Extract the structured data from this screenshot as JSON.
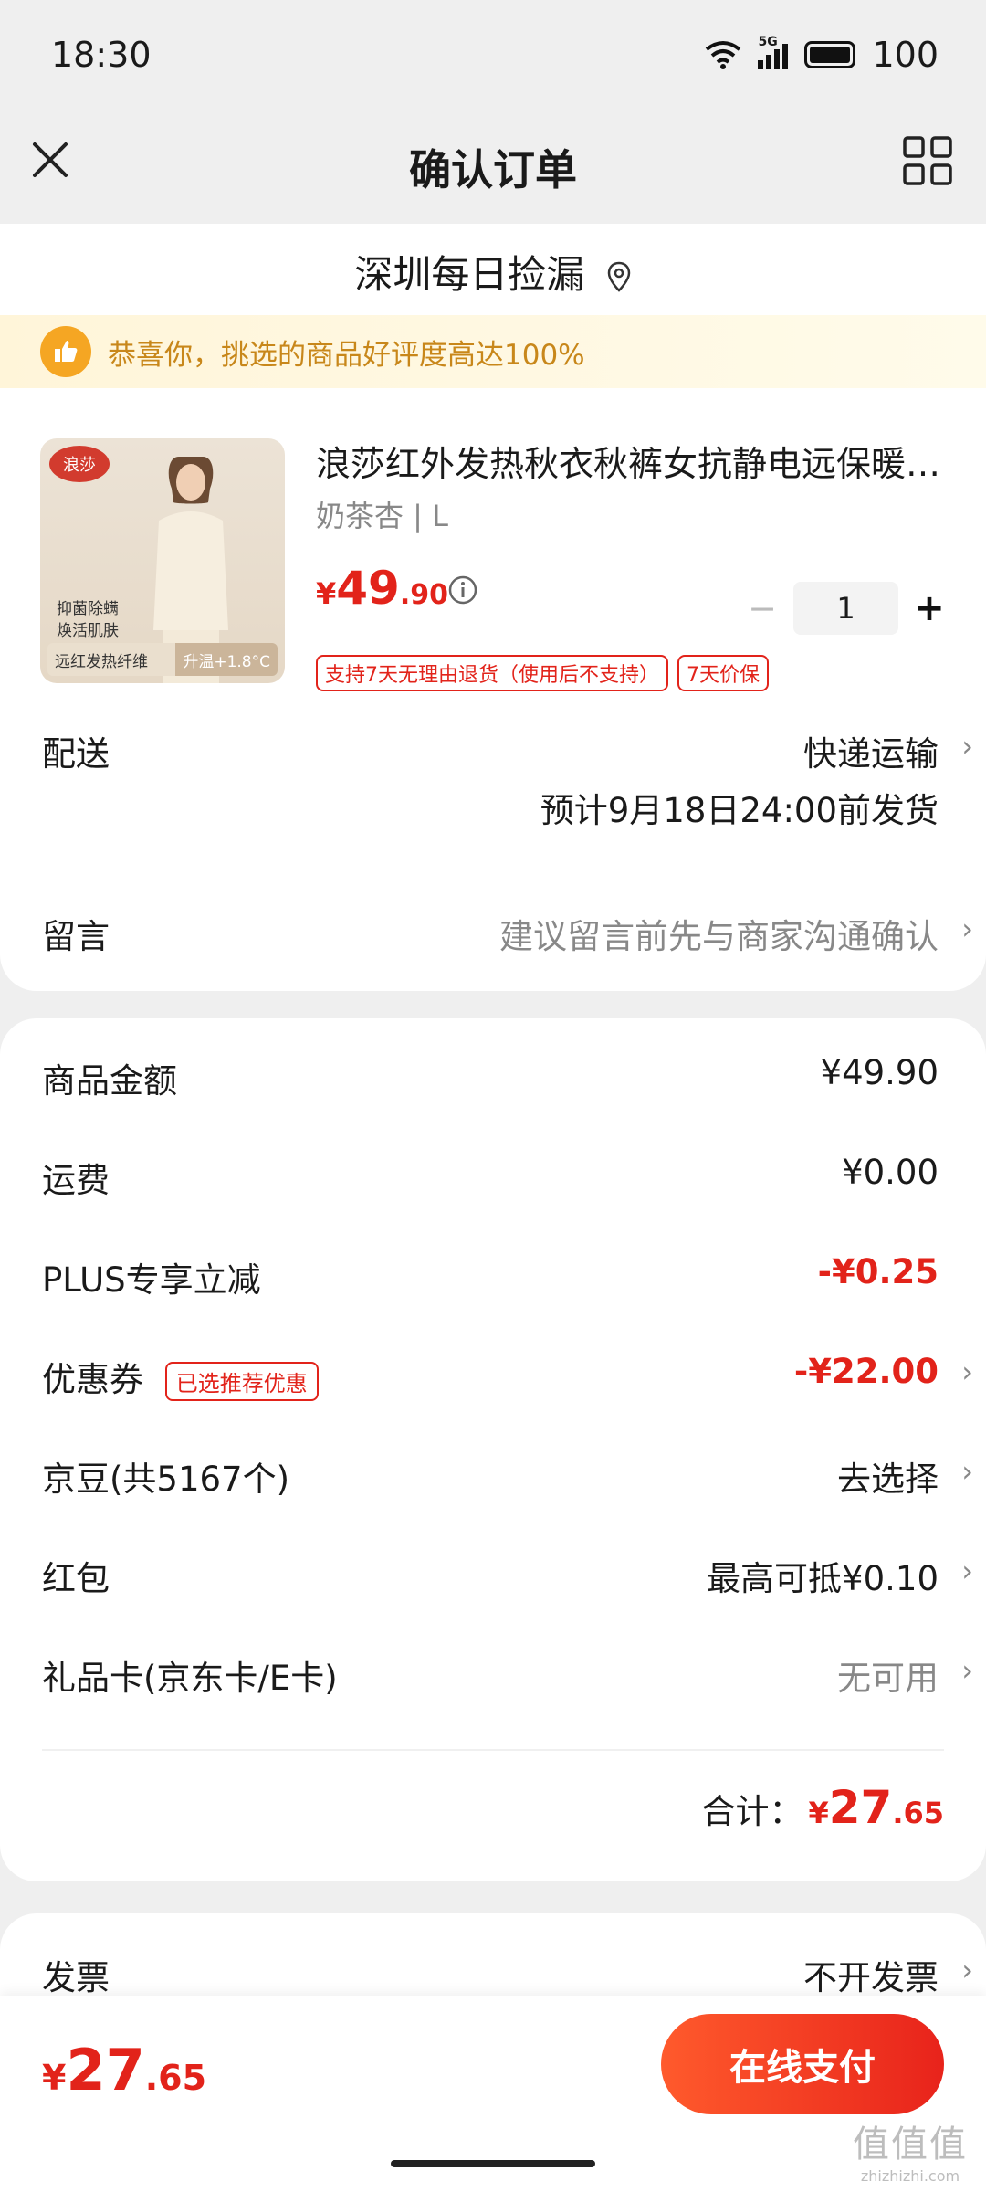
{
  "status_bar": {
    "time": "18:30",
    "network": "5G",
    "battery": "100"
  },
  "header": {
    "title": "确认订单"
  },
  "store": {
    "name": "深圳每日捡漏"
  },
  "banner": {
    "text": "恭喜你，挑选的商品好评度高达100%"
  },
  "product": {
    "image_brand": "浪莎",
    "image_tag_line1": "抑菌除螨",
    "image_tag_line2": "焕活肌肤",
    "image_tag_left": "远红发热纤维",
    "image_tag_right": "升温+1.8°C",
    "title": "浪莎红外发热秋衣秋裤女抗静电远保暖…",
    "spec": "奶茶杏 | L",
    "price_currency": "¥",
    "price_int": "49",
    "price_dec": ".90",
    "quantity": "1",
    "qty_minus": "−",
    "qty_plus": "+",
    "tags": [
      "支持7天无理由退货（使用后不支持）",
      "7天价保"
    ]
  },
  "delivery": {
    "label": "配送",
    "method": "快递运输",
    "eta": "预计9月18日24:00前发货"
  },
  "message": {
    "label": "留言",
    "placeholder": "建议留言前先与商家沟通确认"
  },
  "summary": {
    "goods_label": "商品金额",
    "goods_value": "¥49.90",
    "shipping_label": "运费",
    "shipping_value": "¥0.00",
    "plus_label": "PLUS专享立减",
    "plus_value": "-¥0.25",
    "coupon_label": "优惠券",
    "coupon_badge": "已选推荐优惠",
    "coupon_value": "-¥22.00",
    "jingdou_label": "京豆(共5167个)",
    "jingdou_value": "去选择",
    "hongbao_label": "红包",
    "hongbao_value": "最高可抵¥0.10",
    "giftcard_label": "礼品卡(京东卡/E卡)",
    "giftcard_value": "无可用",
    "total_label": "合计：",
    "total_currency": "¥",
    "total_int": "27",
    "total_dec": ".65"
  },
  "invoice": {
    "label": "发票",
    "value": "不开发票"
  },
  "bottom": {
    "currency": "¥",
    "price_int": "27",
    "price_dec": ".65",
    "pay_label": "在线支付"
  },
  "watermark": {
    "big": "值值值",
    "small": "zhizhizhi.com"
  },
  "colors": {
    "accent_red": "#e2231a",
    "banner_gold": "#c8871a",
    "background": "#efefef"
  }
}
